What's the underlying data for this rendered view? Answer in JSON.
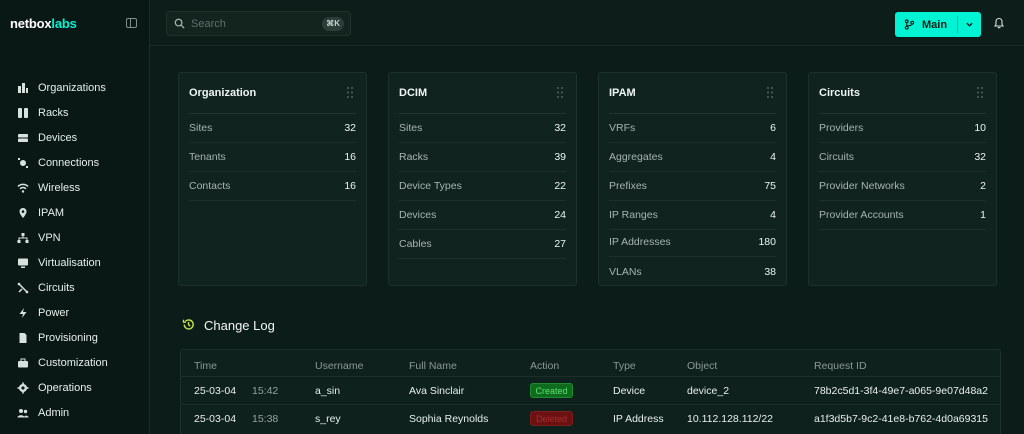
{
  "app": {
    "logo_main": "netbox",
    "logo_accent": "labs"
  },
  "sidebar": {
    "items": [
      {
        "label": "Organizations",
        "icon": "organizations-icon"
      },
      {
        "label": "Racks",
        "icon": "racks-icon"
      },
      {
        "label": "Devices",
        "icon": "devices-icon"
      },
      {
        "label": "Connections",
        "icon": "connections-icon"
      },
      {
        "label": "Wireless",
        "icon": "wireless-icon"
      },
      {
        "label": "IPAM",
        "icon": "location-pin-icon"
      },
      {
        "label": "VPN",
        "icon": "network-icon"
      },
      {
        "label": "Virtualisation",
        "icon": "monitor-icon"
      },
      {
        "label": "Circuits",
        "icon": "circuits-icon"
      },
      {
        "label": "Power",
        "icon": "power-bolt-icon"
      },
      {
        "label": "Provisioning",
        "icon": "document-icon"
      },
      {
        "label": "Customization",
        "icon": "toolbox-icon"
      },
      {
        "label": "Operations",
        "icon": "gear-icon"
      },
      {
        "label": "Admin",
        "icon": "users-icon"
      }
    ]
  },
  "topbar": {
    "search_placeholder": "Search",
    "search_shortcut": "⌘K",
    "branch_label": "Main"
  },
  "colors": {
    "accent": "#00f4d4",
    "created_badge": "#0f6b1e",
    "deleted_badge": "#6a1212"
  },
  "cards": [
    {
      "title": "Organization",
      "rows": [
        {
          "label": "Sites",
          "value": "32"
        },
        {
          "label": "Tenants",
          "value": "16"
        },
        {
          "label": "Contacts",
          "value": "16"
        }
      ]
    },
    {
      "title": "DCIM",
      "rows": [
        {
          "label": "Sites",
          "value": "32"
        },
        {
          "label": "Racks",
          "value": "39"
        },
        {
          "label": "Device Types",
          "value": "22"
        },
        {
          "label": "Devices",
          "value": "24"
        },
        {
          "label": "Cables",
          "value": "27"
        }
      ]
    },
    {
      "title": "IPAM",
      "rows": [
        {
          "label": "VRFs",
          "value": "6"
        },
        {
          "label": "Aggregates",
          "value": "4"
        },
        {
          "label": "Prefixes",
          "value": "75"
        },
        {
          "label": "IP Ranges",
          "value": "4"
        },
        {
          "label": "IP Addresses",
          "value": "180"
        },
        {
          "label": "VLANs",
          "value": "38"
        }
      ]
    },
    {
      "title": "Circuits",
      "rows": [
        {
          "label": "Providers",
          "value": "10"
        },
        {
          "label": "Circuits",
          "value": "32"
        },
        {
          "label": "Provider Networks",
          "value": "2"
        },
        {
          "label": "Provider Accounts",
          "value": "1"
        }
      ]
    }
  ],
  "changelog": {
    "title": "Change Log",
    "columns": [
      "Time",
      "Username",
      "Full Name",
      "Action",
      "Type",
      "Object",
      "Request ID"
    ],
    "rows": [
      {
        "date": "25-03-04",
        "time": "15:42",
        "username": "a_sin",
        "full_name": "Ava Sinclair",
        "action": "Created",
        "type": "Device",
        "object": "device_2",
        "request_id": "78b2c5d1-3f4-49e7-a065-9e07d48a2"
      },
      {
        "date": "25-03-04",
        "time": "15:38",
        "username": "s_rey",
        "full_name": "Sophia Reynolds",
        "action": "Deleted",
        "type": "IP Address",
        "object": "10.112.128.112/22",
        "request_id": "a1f3d5b7-9c2-41e8-b762-4d0a69315"
      }
    ]
  }
}
